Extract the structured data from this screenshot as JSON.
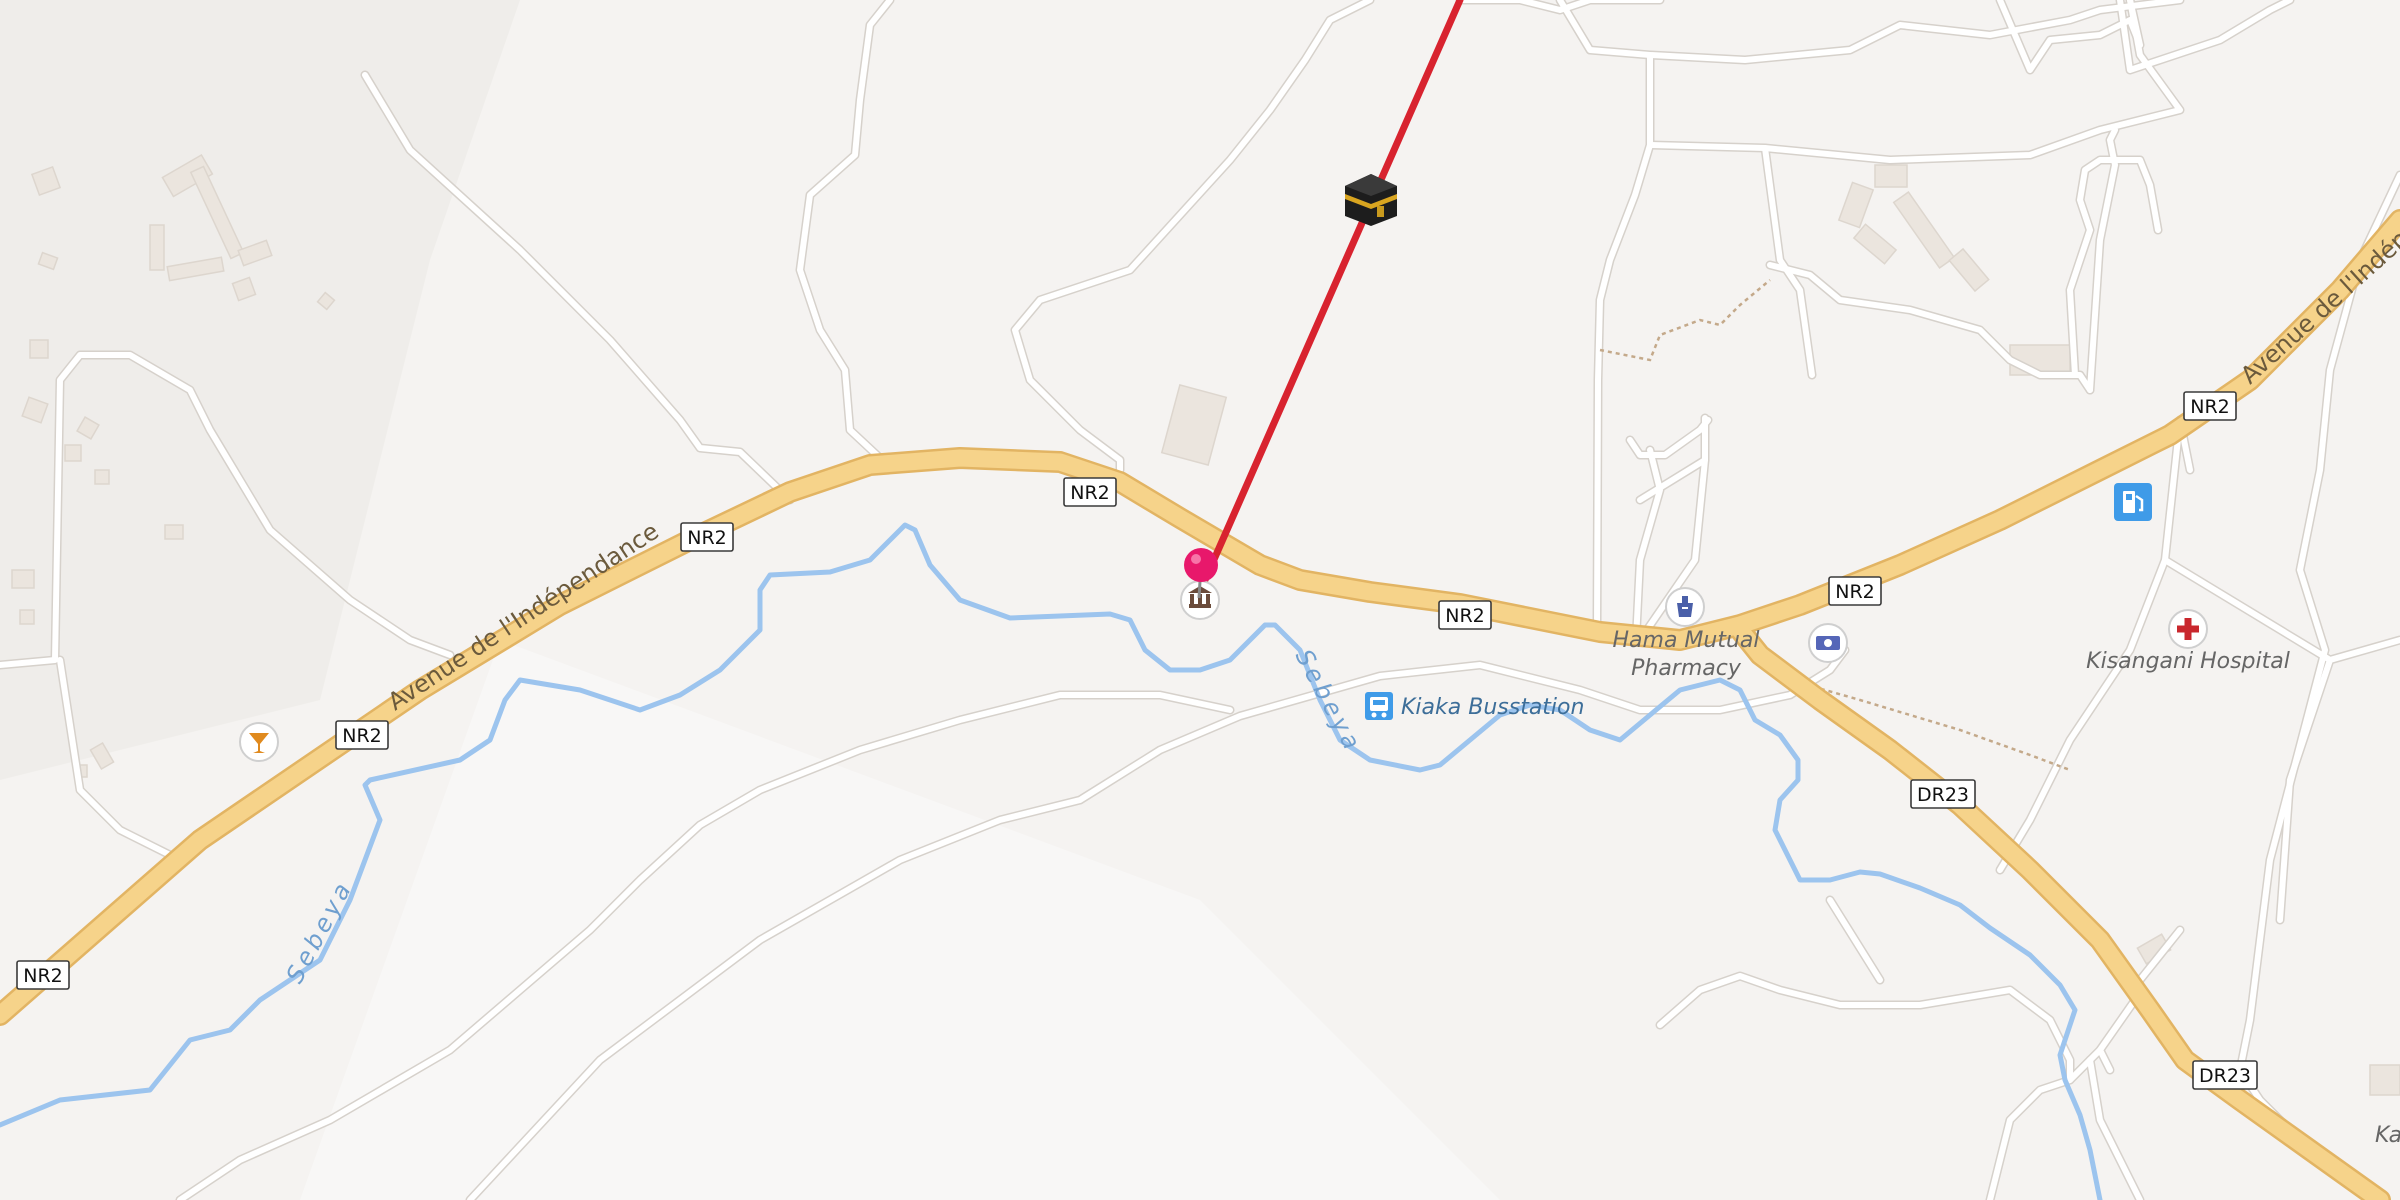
{
  "map": {
    "colors": {
      "land": "#f5f3f1",
      "primary_road": "#f6d38a",
      "primary_road_casing": "#e2b463",
      "minor_road": "#ffffff",
      "minor_road_casing": "#d9d5d0",
      "water": "#9cc4ee",
      "building": "#ebe5de",
      "route_line": "#d8232f",
      "pin": "#e8186b"
    },
    "road_shields": [
      "NR2",
      "NR2",
      "NR2",
      "NR2",
      "NR2",
      "NR2",
      "NR2",
      "DR23",
      "DR23"
    ],
    "street_labels": {
      "avenue_west": "Avenue de l'Indépendance",
      "avenue_east": "Avenue de l'Indépe"
    },
    "water_labels": {
      "river_west": "Sebeya",
      "river_center": "Sebeya"
    },
    "pois": {
      "pharmacy": "Hama Mutual Pharmacy",
      "pharmacy_line1": "Hama Mutual",
      "pharmacy_line2": "Pharmacy",
      "bus_station": "Kiaka Busstation",
      "hospital": "Kisangani Hospital",
      "partial_label": "Ka"
    },
    "icons": {
      "pin": "map-pin-icon",
      "kaaba": "kaaba-icon",
      "museum": "museum-icon",
      "bar": "cocktail-icon",
      "pharmacy": "pharmacy-icon",
      "bank": "banknote-icon",
      "fuel": "fuel-icon",
      "hospital": "hospital-cross-icon",
      "bus": "bus-icon"
    }
  }
}
